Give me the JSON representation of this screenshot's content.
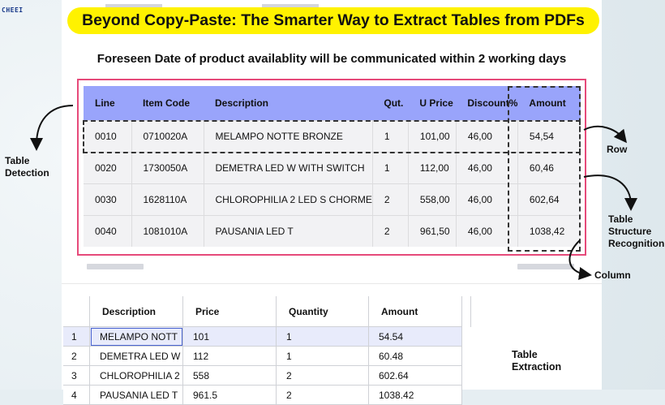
{
  "logo_text": "CHEEI",
  "title": "Beyond Copy-Paste: The Smarter Way to Extract Tables from PDFs",
  "subtitle": "Foreseen Date of product availablity will be communicated within 2 working days",
  "source_table": {
    "headers": [
      "Line",
      "Item Code",
      "Description",
      "Qut.",
      "U Price",
      "Discount%",
      "Amount"
    ],
    "rows": [
      [
        "0010",
        "0710020A",
        "MELAMPO NOTTE BRONZE",
        "1",
        "101,00",
        "46,00",
        "54,54"
      ],
      [
        "0020",
        "1730050A",
        "DEMETRA LED W WITH SWITCH",
        "1",
        "112,00",
        "46,00",
        "60,46"
      ],
      [
        "0030",
        "1628110A",
        "CHLOROPHILIA 2 LED S CHORME",
        "2",
        "558,00",
        "46,00",
        "602,64"
      ],
      [
        "0040",
        "1081010A",
        "PAUSANIA LED T",
        "2",
        "961,50",
        "46,00",
        "1038,42"
      ]
    ]
  },
  "annotations": {
    "table_detection": [
      "Table",
      "Detection"
    ],
    "row": "Row",
    "structure": [
      "Table",
      "Structure",
      "Recognition"
    ],
    "column": "Column",
    "extraction": [
      "Table",
      "Extraction"
    ]
  },
  "extracted_table": {
    "headers": [
      "Description",
      "Price",
      "Quantity",
      "Amount"
    ],
    "rows": [
      {
        "num": "1",
        "cells": [
          "MELAMPO NOTT",
          "101",
          "1",
          "54.54"
        ]
      },
      {
        "num": "2",
        "cells": [
          "DEMETRA LED W",
          "112",
          "1",
          "60.48"
        ]
      },
      {
        "num": "3",
        "cells": [
          "CHLOROPHILIA 2",
          "558",
          "2",
          "602.64"
        ]
      },
      {
        "num": "4",
        "cells": [
          "PAUSANIA LED T",
          "961.5",
          "2",
          "1038.42"
        ]
      }
    ]
  },
  "colors": {
    "title_bg": "#fff200",
    "header_bg": "#99a4fb",
    "detection_border": "#e64a7a",
    "selection_border": "#4a64d0"
  }
}
